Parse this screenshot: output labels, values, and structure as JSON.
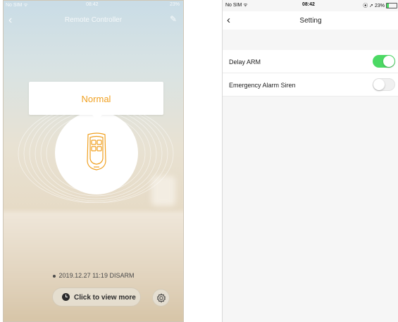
{
  "left_screen": {
    "status_bar": {
      "carrier": "No SIM ᯤ",
      "time": "08:42",
      "battery": "23%"
    },
    "nav": {
      "title": "Remote Controller"
    },
    "mode_label": "Normal",
    "history": "2019.12.27 11:19 DISARM",
    "view_more_label": "Click to view more",
    "colors": {
      "accent": "#f0a020"
    }
  },
  "right_screen": {
    "status_bar": {
      "carrier": "No SIM ᯤ",
      "time": "08:42",
      "battery": "⦿ ➚ 23%"
    },
    "nav": {
      "title": "Setting"
    },
    "settings": [
      {
        "label": "Delay ARM",
        "enabled": true
      },
      {
        "label": "Emergency Alarm Siren",
        "enabled": false
      }
    ],
    "colors": {
      "toggle_on": "#4cd964"
    }
  }
}
